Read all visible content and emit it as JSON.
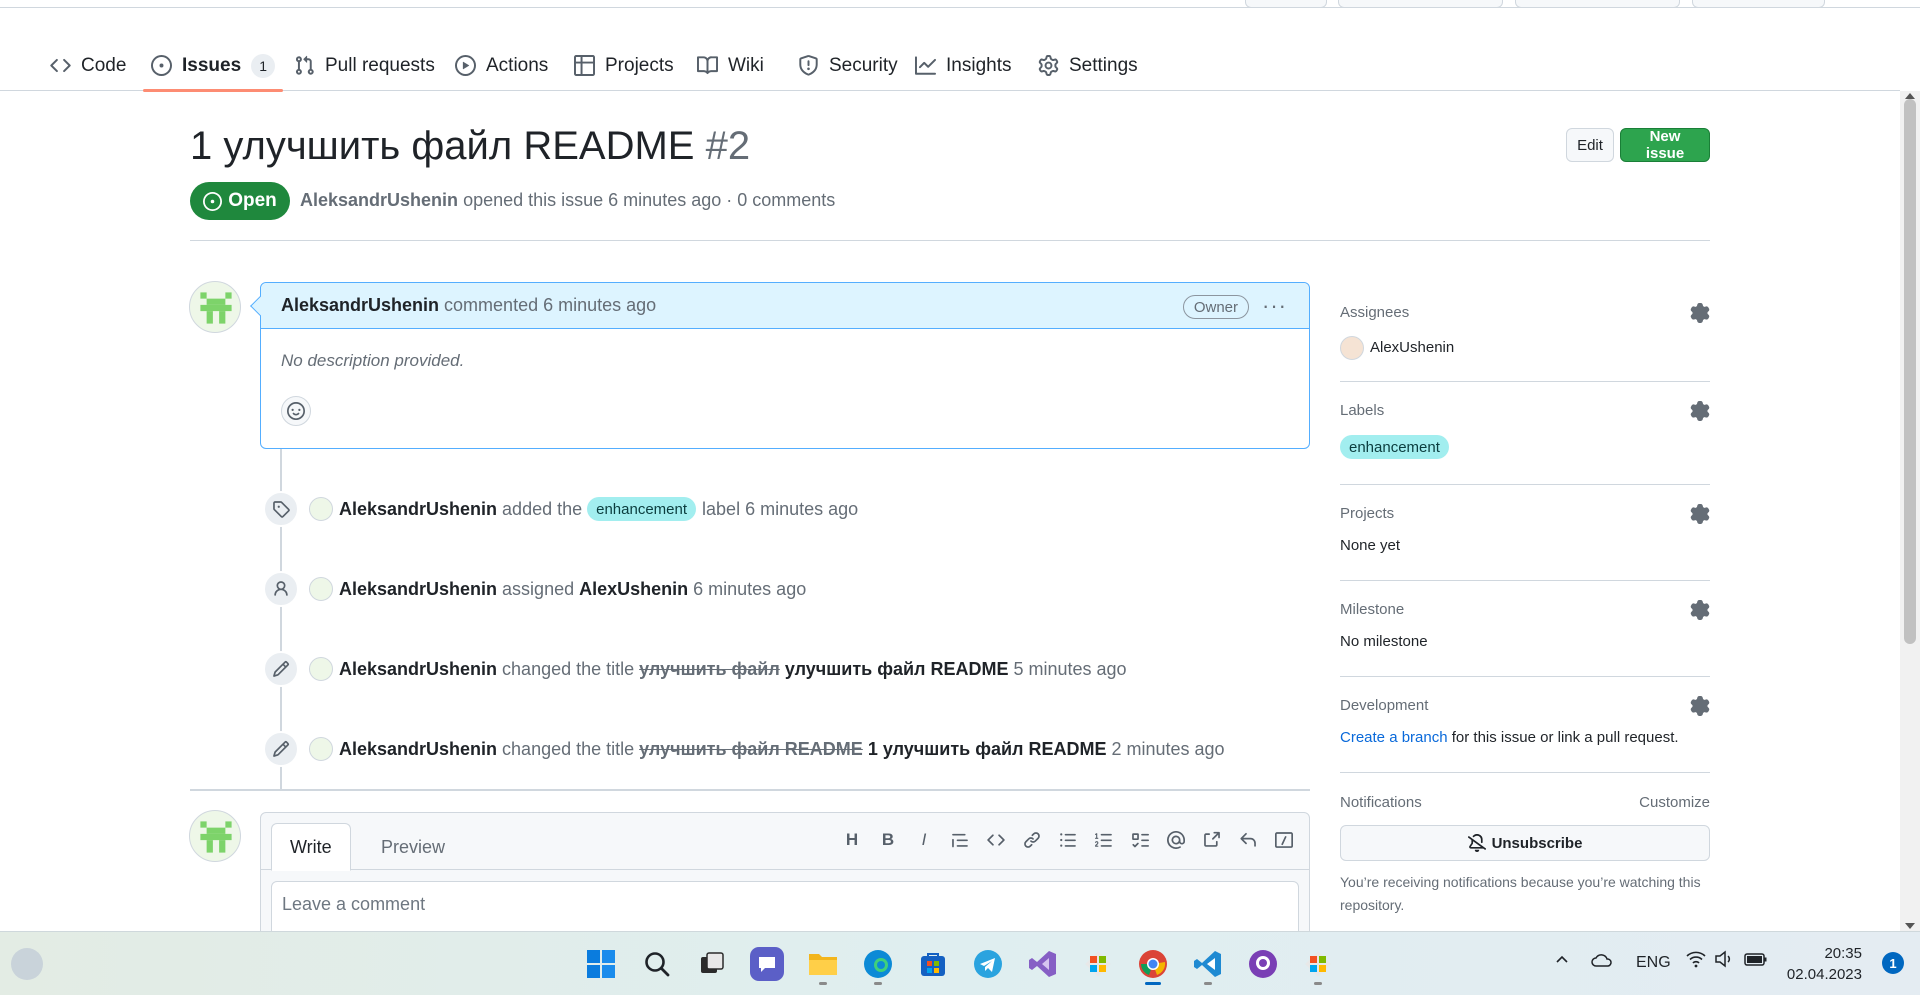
{
  "nav": {
    "tabs": [
      {
        "label": "Code",
        "icon": "code-icon"
      },
      {
        "label": "Issues",
        "icon": "issue-opened-icon",
        "count": "1"
      },
      {
        "label": "Pull requests",
        "icon": "git-pull-request-icon"
      },
      {
        "label": "Actions",
        "icon": "play-icon"
      },
      {
        "label": "Projects",
        "icon": "table-icon"
      },
      {
        "label": "Wiki",
        "icon": "book-icon"
      },
      {
        "label": "Security",
        "icon": "shield-icon"
      },
      {
        "label": "Insights",
        "icon": "graph-icon"
      },
      {
        "label": "Settings",
        "icon": "gear-icon"
      }
    ],
    "active_tab": "Issues"
  },
  "issue": {
    "title": "1 улучшить файл README",
    "number": "#2",
    "state": "Open",
    "author": "AleksandrUshenin",
    "meta_text": "opened this issue 6 minutes ago · 0 comments",
    "edit_label": "Edit",
    "new_issue_label": "New issue"
  },
  "comment": {
    "author": "AleksandrUshenin",
    "action": "commented 6 minutes ago",
    "badge": "Owner",
    "menu": "···",
    "body": "No description provided."
  },
  "timeline": [
    {
      "icon": "tag-icon",
      "actor": "AleksandrUshenin",
      "text_before": "added the",
      "label": "enhancement",
      "text_after": "label 6 minutes ago"
    },
    {
      "icon": "person-icon",
      "actor": "AleksandrUshenin",
      "text_before": "assigned",
      "target": "AlexUshenin",
      "text_after": "6 minutes ago"
    },
    {
      "icon": "pencil-icon",
      "actor": "AleksandrUshenin",
      "text_before": "changed the title",
      "old_title": "улучшить файл",
      "new_title": "улучшить файл README",
      "text_after": "5 minutes ago"
    },
    {
      "icon": "pencil-icon",
      "actor": "AleksandrUshenin",
      "text_before": "changed the title",
      "old_title": "улучшить файл README",
      "new_title": "1 улучшить файл README",
      "text_after": "2 minutes ago"
    }
  ],
  "composer": {
    "tab_write": "Write",
    "tab_preview": "Preview",
    "placeholder": "Leave a comment",
    "heading_glyph": "H",
    "bold_glyph": "B",
    "italic_glyph": "I"
  },
  "sidebar": {
    "assignees": {
      "title": "Assignees",
      "value": "AlexUshenin"
    },
    "labels": {
      "title": "Labels",
      "value": "enhancement"
    },
    "projects": {
      "title": "Projects",
      "value": "None yet"
    },
    "milestone": {
      "title": "Milestone",
      "value": "No milestone"
    },
    "development": {
      "title": "Development",
      "link": "Create a branch",
      "rest": "for this issue or link a pull request."
    },
    "notifications": {
      "title": "Notifications",
      "customize": "Customize",
      "button": "Unsubscribe",
      "note": "You’re receiving notifications because you’re watching this repository."
    }
  },
  "taskbar": {
    "lang": "ENG",
    "time": "20:35",
    "date": "02.04.2023",
    "notifications": "1"
  },
  "colors": {
    "accent_green": "#1f883d",
    "label_enhancement": "#a2eeef",
    "comment_header": "#ddf4ff",
    "active_tab_underline": "#fd8c73",
    "link_blue": "#0969da"
  }
}
